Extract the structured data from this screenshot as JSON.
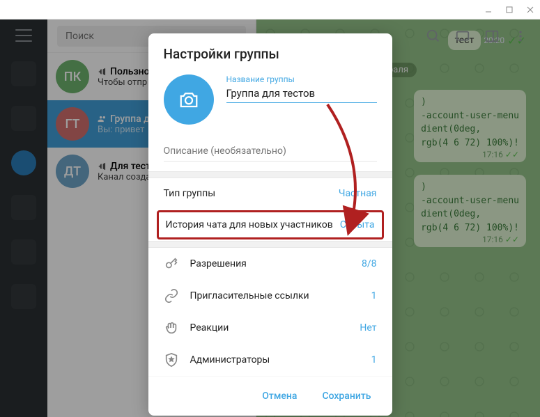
{
  "search": {
    "placeholder": "Поиск"
  },
  "chats": [
    {
      "avatar": "ПК",
      "color": "#6fb36f",
      "title": "Пользно",
      "sub": "Чтобы отпр"
    },
    {
      "avatar": "ГТ",
      "color": "#d2706f",
      "title": "Группа д",
      "sub": "Вы: привет"
    },
    {
      "avatar": "ДТ",
      "color": "#6fa5c8",
      "title": "Для тест",
      "sub": "Канал созда"
    }
  ],
  "conversation": {
    "date": "раля",
    "msg1": {
      "text": "тест",
      "time": "20:20"
    },
    "msg2": {
      "code": ")\n-account-user-menu\ndient(0deg,\nrgb(4 6 72) 100%)!",
      "time": "17:16"
    },
    "msg3": {
      "code": ")\n-account-user-menu\ndient(0deg,\nrgb(4 6 72) 100%)!",
      "time": "17:16"
    }
  },
  "modal": {
    "title": "Настройки группы",
    "group_name_label": "Название группы",
    "group_name_value": "Группа для тестов",
    "desc_placeholder": "Описание (необязательно)",
    "type": {
      "label": "Тип группы",
      "value": "Частная"
    },
    "history": {
      "label": "История чата для новых участников",
      "value": "Скрыта"
    },
    "permissions": {
      "label": "Разрешения",
      "value": "8/8"
    },
    "invite": {
      "label": "Пригласительные ссылки",
      "value": "1"
    },
    "reactions": {
      "label": "Реакции",
      "value": "Нет"
    },
    "admins": {
      "label": "Администраторы",
      "value": "1"
    },
    "cancel": "Отмена",
    "save": "Сохранить"
  }
}
